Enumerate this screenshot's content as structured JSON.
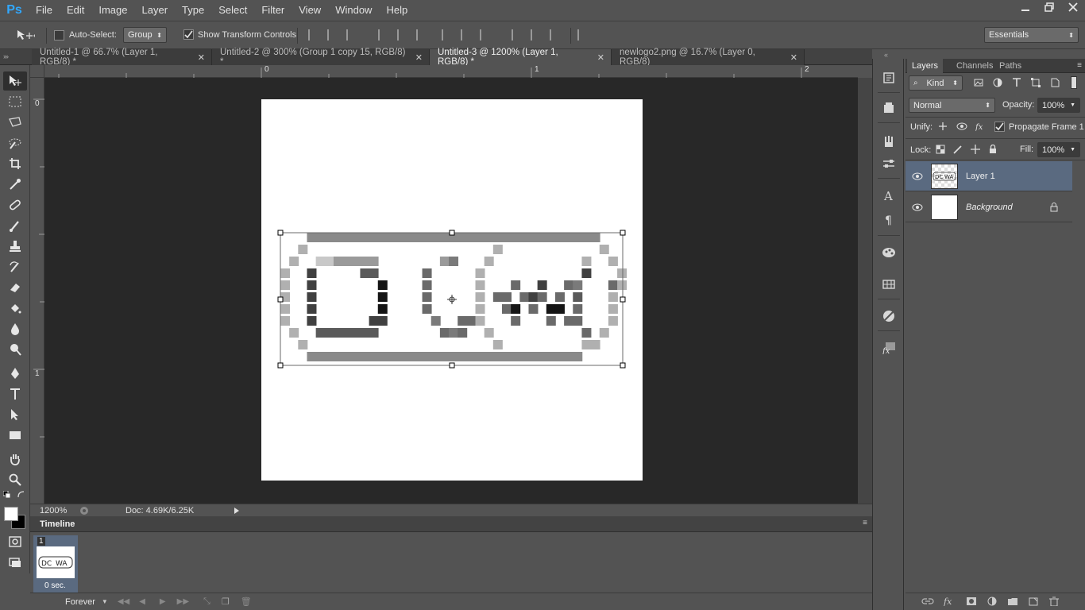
{
  "app": {
    "logo": "Ps",
    "menu": [
      "File",
      "Edit",
      "Image",
      "Layer",
      "Type",
      "Select",
      "Filter",
      "View",
      "Window",
      "Help"
    ]
  },
  "options": {
    "auto_select_label": "Auto-Select:",
    "auto_select_checked": false,
    "target_value": "Group",
    "show_transform_label": "Show Transform Controls",
    "show_transform_checked": true,
    "workspace": "Essentials"
  },
  "tabs": [
    {
      "label": "Untitled-1 @ 66.7% (Layer 1, RGB/8) *",
      "active": false
    },
    {
      "label": "Untitled-2 @ 300% (Group 1 copy 15, RGB/8) *",
      "active": false
    },
    {
      "label": "Untitled-3 @ 1200% (Layer 1, RGB/8) *",
      "active": true
    },
    {
      "label": "newlogo2.png @ 16.7% (Layer 0, RGB/8)",
      "active": false
    }
  ],
  "rulers": {
    "top": [
      "0",
      "1",
      "2"
    ],
    "left": [
      "0",
      "1"
    ]
  },
  "status": {
    "zoom": "1200%",
    "doc_info": "Doc: 4.69K/6.25K"
  },
  "timeline": {
    "title": "Timeline",
    "frame_number": "1",
    "frame_delay": "0 sec.",
    "loop": "Forever"
  },
  "layers_panel": {
    "tabs": [
      "Layers",
      "Channels",
      "Paths"
    ],
    "filter_kind": "Kind",
    "blend_mode": "Normal",
    "opacity_label": "Opacity:",
    "opacity_value": "100%",
    "unify_label": "Unify:",
    "propagate_label": "Propagate Frame 1",
    "propagate_checked": true,
    "lock_label": "Lock:",
    "fill_label": "Fill:",
    "fill_value": "100%",
    "layers": [
      {
        "name": "Layer 1",
        "visible": true,
        "selected": true,
        "locked": false
      },
      {
        "name": "Background",
        "visible": true,
        "selected": false,
        "locked": true
      }
    ]
  },
  "colors": {
    "selected_layer": "#5a6a80",
    "ps_blue": "#31a8ff",
    "foreground": "#ffffff",
    "background": "#000000"
  }
}
